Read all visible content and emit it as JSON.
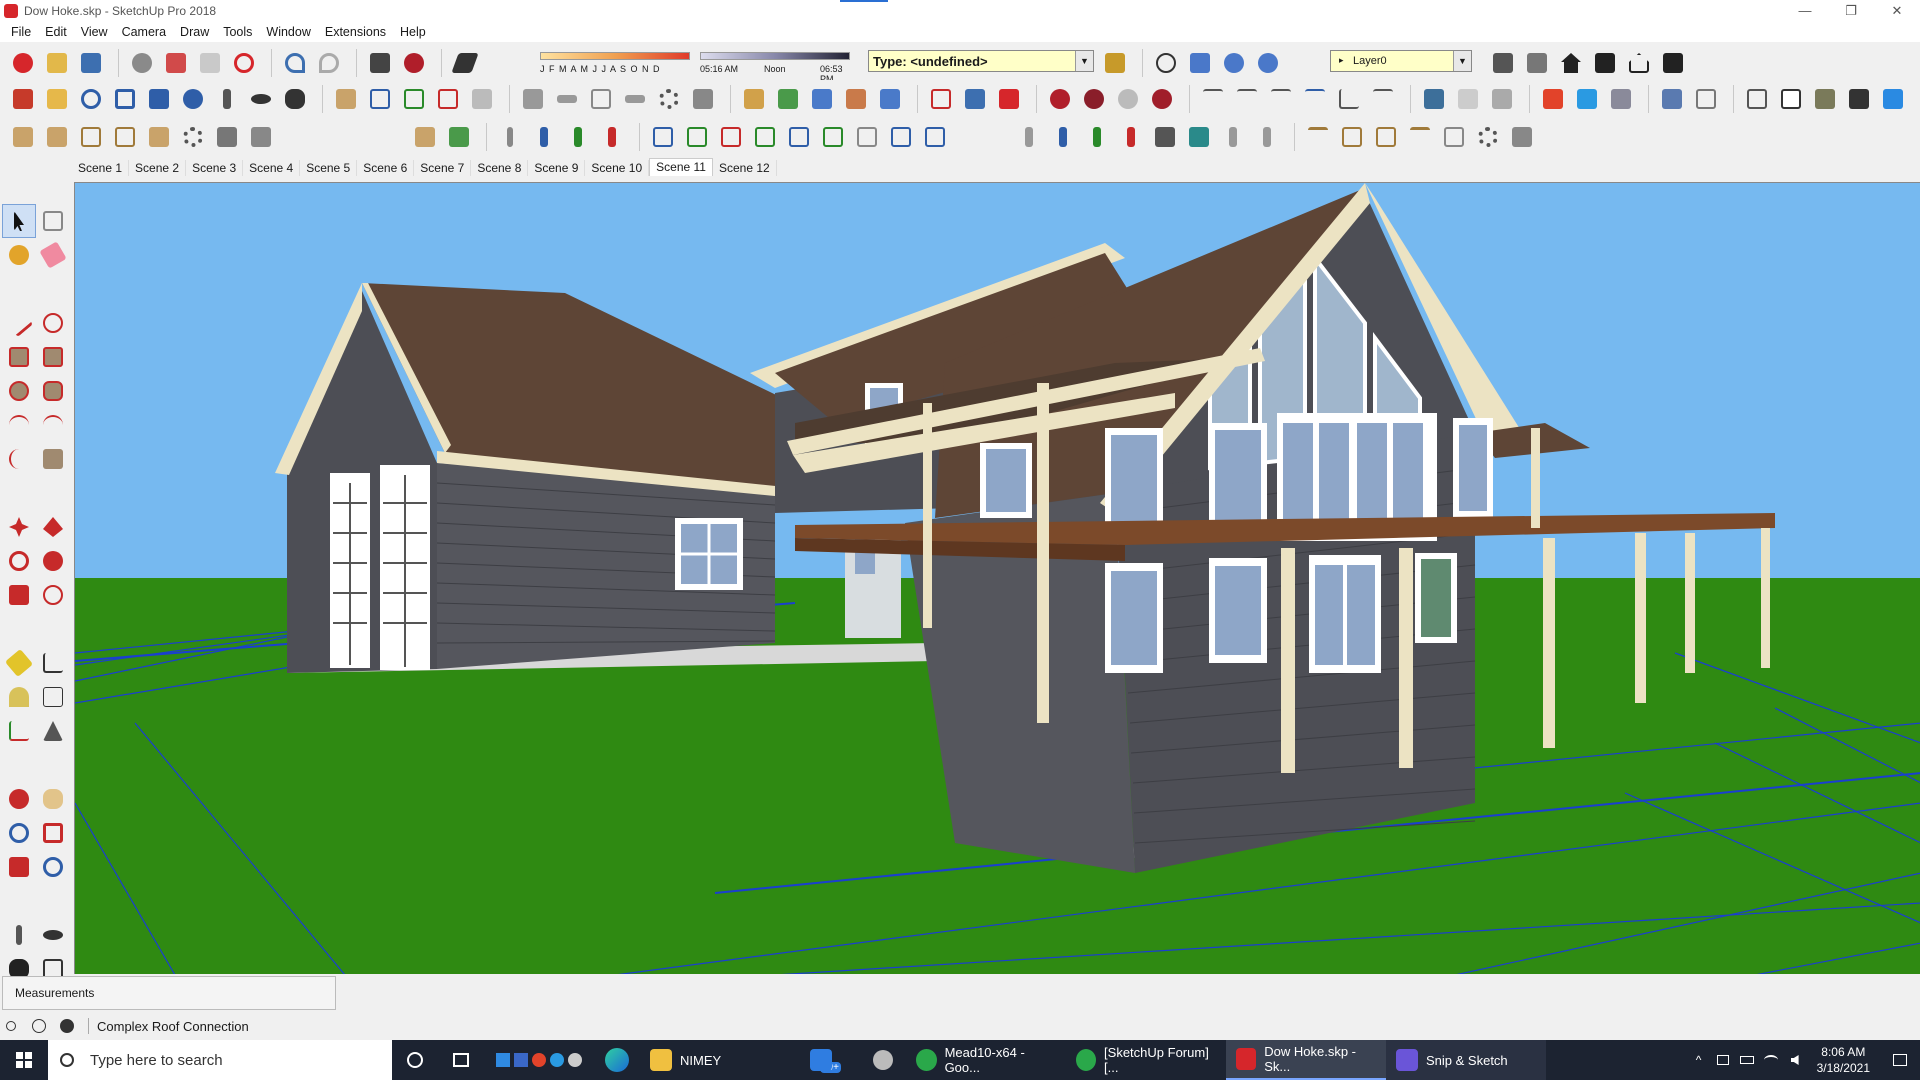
{
  "window": {
    "title": "Dow Hoke.skp - SketchUp Pro 2018",
    "controls": [
      "—",
      "❐",
      "✕"
    ]
  },
  "menu": [
    "File",
    "Edit",
    "View",
    "Camera",
    "Draw",
    "Tools",
    "Window",
    "Extensions",
    "Help"
  ],
  "shadows": {
    "months": "J F M A M J J A S O N D",
    "time_start": "05:16 AM",
    "time_mid": "Noon",
    "time_end": "06:53 PM"
  },
  "type_dropdown": {
    "value": "Type: <undefined>"
  },
  "layer_dropdown": {
    "value": "Layer0",
    "marker": "▸"
  },
  "scenes": [
    "Scene 1",
    "Scene 2",
    "Scene 3",
    "Scene 4",
    "Scene 5",
    "Scene 6",
    "Scene 7",
    "Scene 8",
    "Scene 9",
    "Scene 10",
    "Scene 11",
    "Scene 12"
  ],
  "active_scene": "Scene 11",
  "measurements": {
    "label": "Measurements"
  },
  "status": {
    "text": "Complex Roof Connection"
  },
  "taskbar": {
    "search_placeholder": "Type here to search",
    "apps": [
      {
        "label": "NIMEY",
        "color": "#f0c040"
      },
      {
        "label": "99+",
        "color": "#2f7de1"
      },
      {
        "label": "Mead10-x64 - Goo...",
        "color": "#2aa84a"
      },
      {
        "label": "[SketchUp Forum] [...",
        "color": "#2aa84a"
      },
      {
        "label": "Dow Hoke.skp - Sk...",
        "color": "#d6262b"
      },
      {
        "label": "Snip & Sketch",
        "color": "#6a55d8"
      }
    ],
    "time": "8:06 AM",
    "date": "3/18/2021"
  },
  "colors": {
    "sky": "#76b9f0",
    "ground": "#2f8a12",
    "siding": "#4d4e55",
    "roof": "#5e4536",
    "trim": "#ece3c3",
    "deck": "#7c4a2a",
    "axis_blue": "#1a3fd0"
  }
}
